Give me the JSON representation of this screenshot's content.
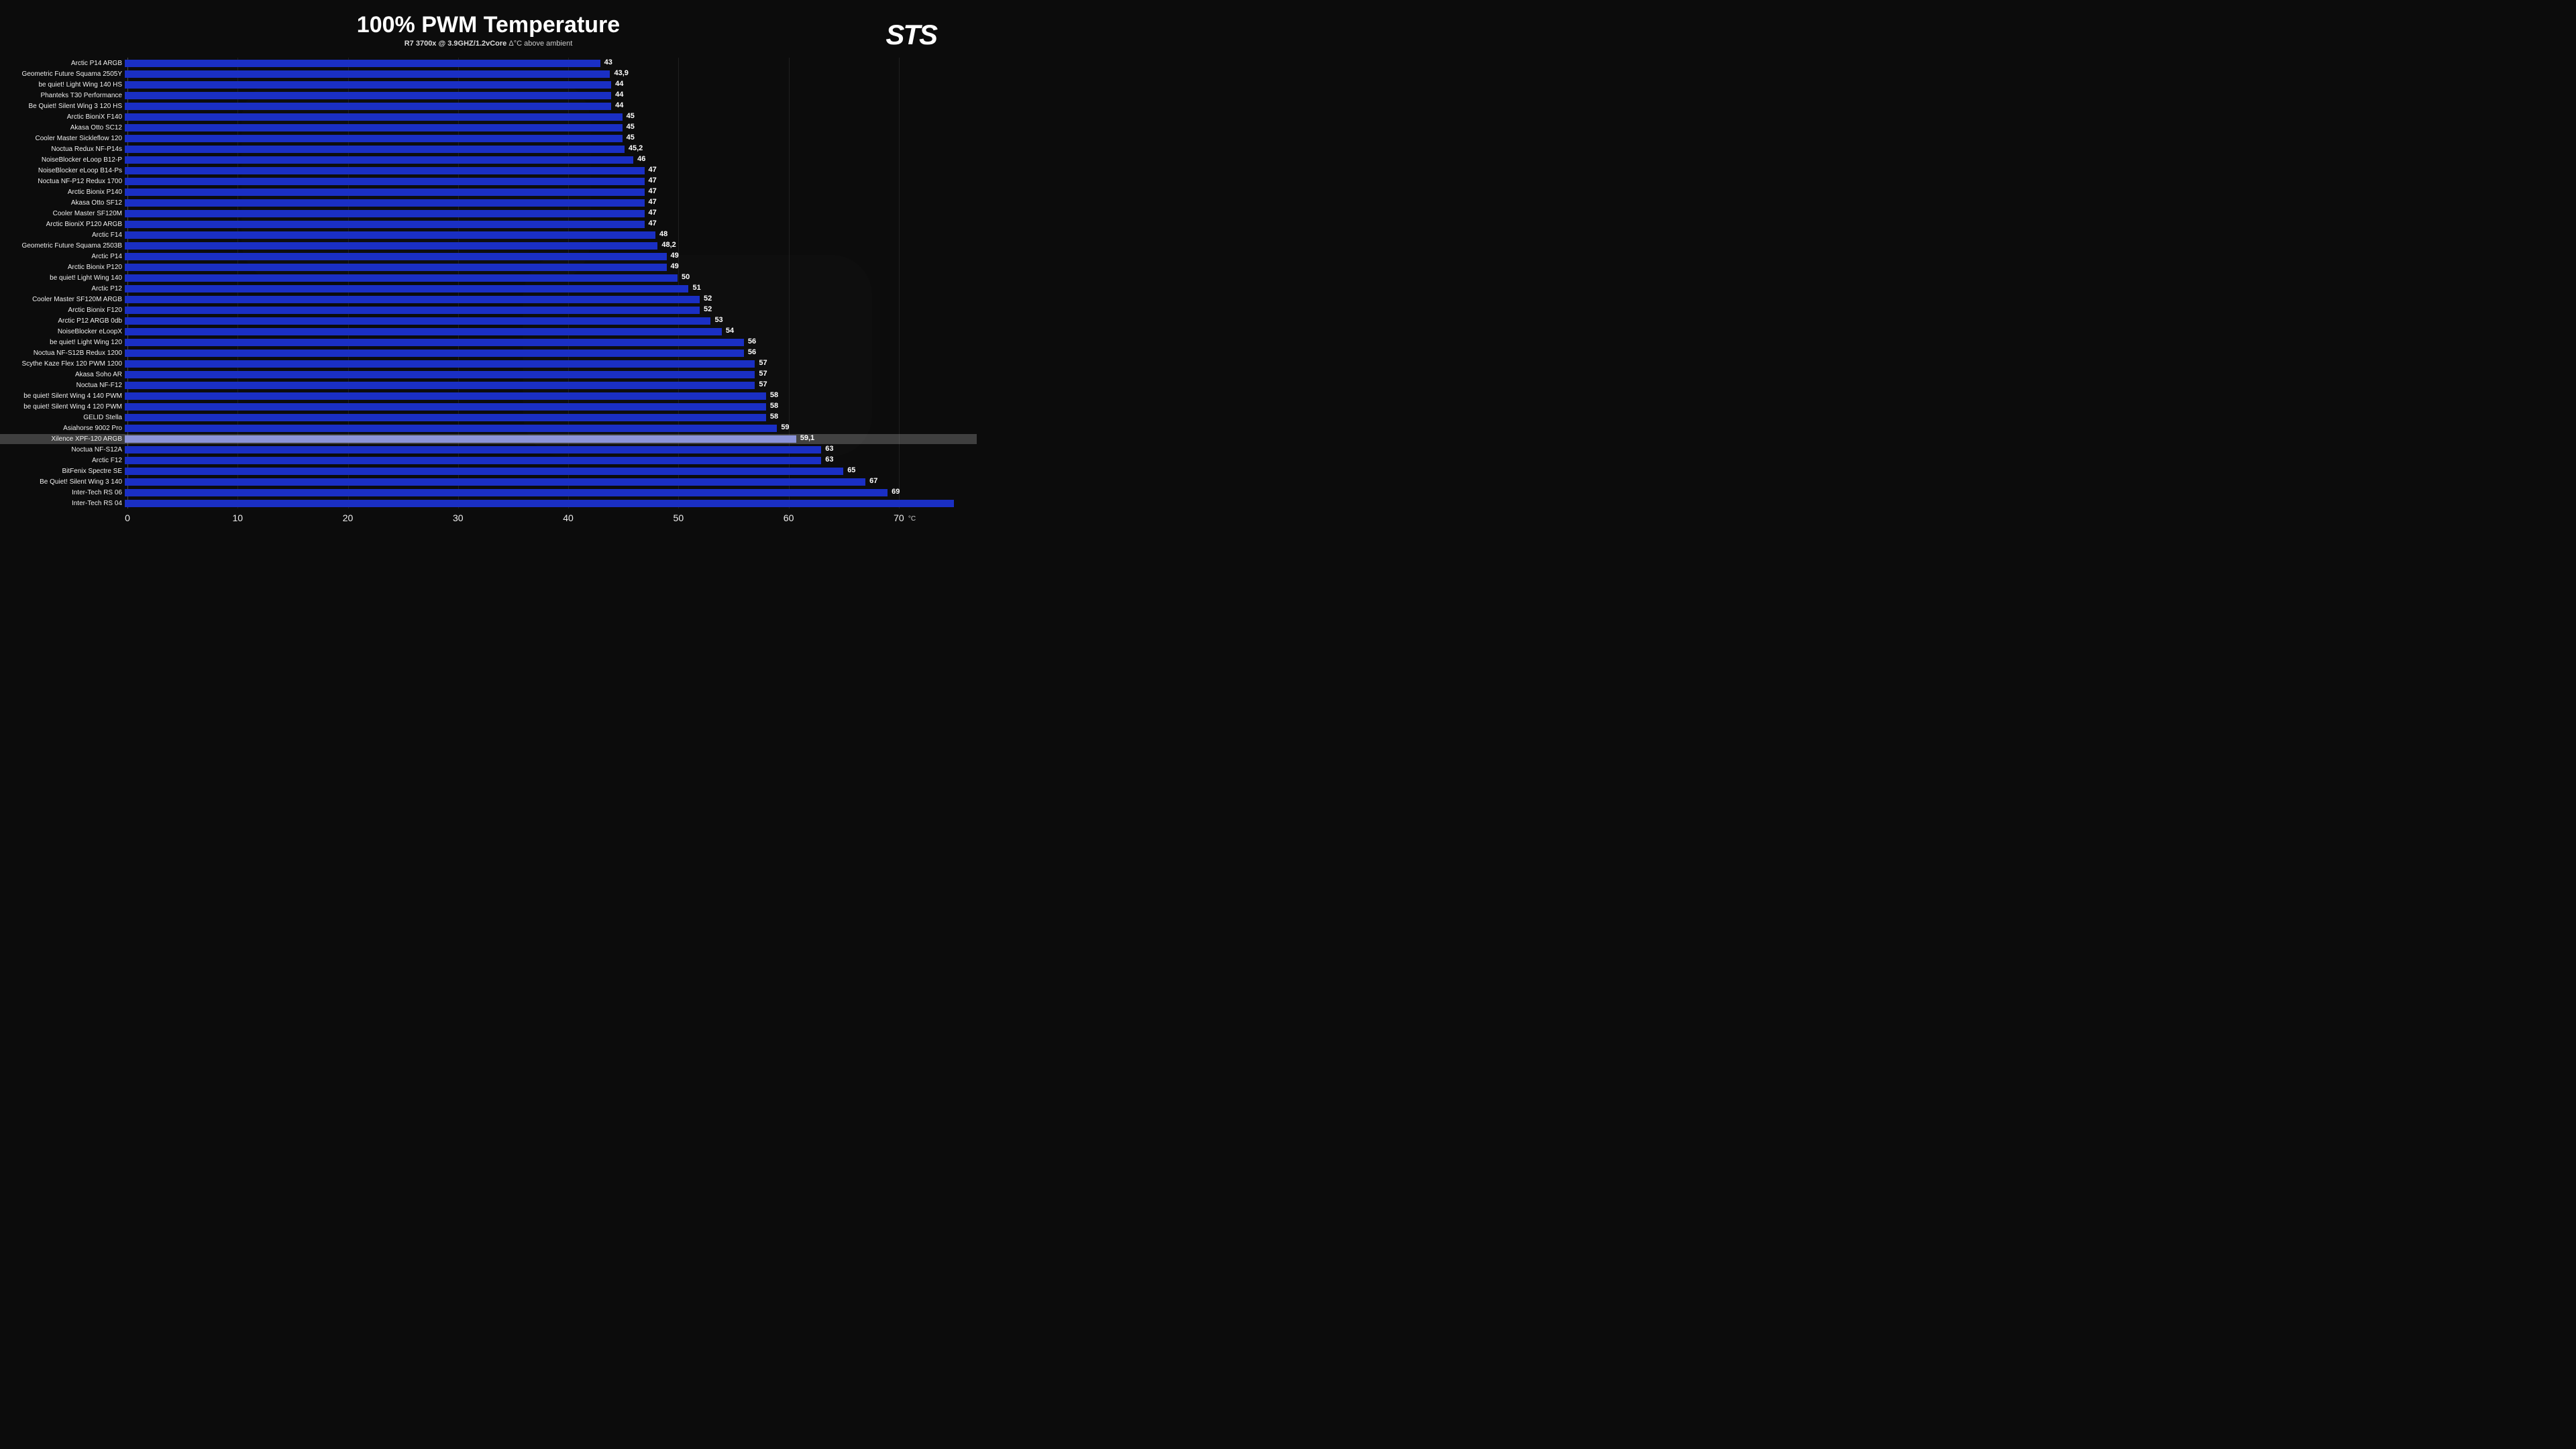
{
  "title": "100% PWM Temperature",
  "subtitle_bold": "R7 3700x @ 3.9GHZ/1.2vCore",
  "subtitle_light": " Δ°C above ambient",
  "watermark": "STS",
  "x_unit": "°C",
  "chart_data": {
    "type": "bar",
    "orientation": "horizontal",
    "title": "100% PWM Temperature",
    "xlabel": "°C",
    "ylabel": "",
    "xlim": [
      0,
      75
    ],
    "xticks": [
      0,
      10,
      20,
      30,
      40,
      50,
      60,
      70
    ],
    "highlighted": "Xilence XPF-120 ARGB",
    "categories": [
      "Arctic P14 ARGB",
      "Geometric Future Squama 2505Y",
      "be quiet! Light Wing 140 HS",
      "Phanteks T30 Performance",
      "Be Quiet! Silent Wing 3 120 HS",
      "Arctic BioniX F140",
      "Akasa Otto SC12",
      "Cooler Master Sickleflow 120",
      "Noctua Redux NF-P14s",
      "NoiseBlocker eLoop B12-P",
      "NoiseBlocker eLoop B14-Ps",
      "Noctua NF-P12 Redux 1700",
      "Arctic Bionix P140",
      "Akasa Otto SF12",
      "Cooler Master SF120M",
      "Arctic BioniX P120 ARGB",
      "Arctic F14",
      "Geometric Future Squama 2503B",
      "Arctic P14",
      "Arctic Bionix P120",
      "be quiet! Light Wing 140",
      "Arctic P12",
      "Cooler Master SF120M ARGB",
      "Arctic Bionix F120",
      "Arctic P12 ARGB 0db",
      "NoiseBlocker eLoopX",
      "be quiet! Light Wing 120",
      "Noctua NF-S12B Redux 1200",
      "Scythe Kaze Flex 120 PWM 1200",
      "Akasa Soho AR",
      "Noctua NF-F12",
      "be quiet! Silent Wing 4 140 PWM",
      "be quiet! Silent Wing 4 120 PWM",
      "GELID Stella",
      "Asiahorse 9002 Pro",
      "Xilence XPF-120 ARGB",
      "Noctua NF-S12A",
      "Arctic F12",
      "BitFenix Spectre SE",
      "Be Quiet! Silent Wing 3 140",
      "Inter-Tech RS 06",
      "Inter-Tech RS 04"
    ],
    "values": [
      43,
      43.9,
      44,
      44,
      44,
      45,
      45,
      45,
      45.2,
      46,
      47,
      47,
      47,
      47,
      47,
      47,
      48,
      48.2,
      49,
      49,
      50,
      51,
      52,
      52,
      53,
      54,
      56,
      56,
      57,
      57,
      57,
      58,
      58,
      58,
      59,
      59.1,
      63,
      63,
      65,
      67,
      69,
      75
    ],
    "value_labels": [
      "43",
      "43,9",
      "44",
      "44",
      "44",
      "45",
      "45",
      "45",
      "45,2",
      "46",
      "47",
      "47",
      "47",
      "47",
      "47",
      "47",
      "48",
      "48,2",
      "49",
      "49",
      "50",
      "51",
      "52",
      "52",
      "53",
      "54",
      "56",
      "56",
      "57",
      "57",
      "57",
      "58",
      "58",
      "58",
      "59",
      "59,1",
      "63",
      "63",
      "65",
      "67",
      "69",
      ""
    ]
  }
}
